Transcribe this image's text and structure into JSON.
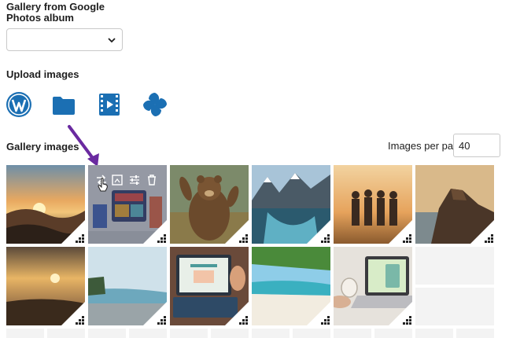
{
  "google_photos": {
    "label": "Gallery from Google Photos album",
    "selected": ""
  },
  "upload": {
    "label": "Upload images",
    "sources": [
      {
        "name": "wordpress-icon"
      },
      {
        "name": "folder-icon"
      },
      {
        "name": "video-icon"
      },
      {
        "name": "google-photos-pinwheel-icon"
      }
    ]
  },
  "gallery": {
    "label": "Gallery images",
    "per_page_label": "Images per page",
    "per_page_value": "40",
    "hover_tools": [
      "replace-icon",
      "crop-icon",
      "settings-sliders-icon",
      "trash-icon"
    ],
    "images": [
      {
        "name": "sunset-over-mountains"
      },
      {
        "name": "social-media-illustration"
      },
      {
        "name": "waving-bear"
      },
      {
        "name": "mountain-lake"
      },
      {
        "name": "friends-at-sunset"
      },
      {
        "name": "coastal-cliff"
      },
      {
        "name": "beach-sunset"
      },
      {
        "name": "pebble-beach"
      },
      {
        "name": "tablet-social-media-snapshot"
      },
      {
        "name": "tropical-beach"
      },
      {
        "name": "laptop-and-coffee"
      }
    ]
  },
  "colors": {
    "accent_blue": "#1b6fb3",
    "arrow_purple": "#6a2aa0"
  }
}
